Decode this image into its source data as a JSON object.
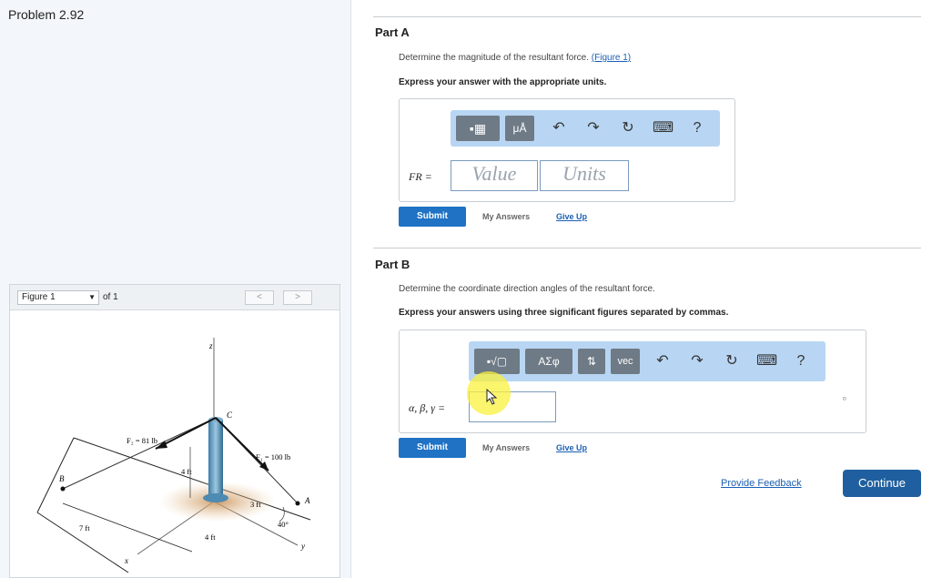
{
  "problem": {
    "title": "Problem 2.92"
  },
  "figure_panel": {
    "select_value": "Figure 1",
    "of_label": "of 1",
    "prev": "<",
    "next": ">",
    "labels": {
      "z": "z",
      "y": "y",
      "x": "x",
      "A": "A",
      "B": "B",
      "C": "C",
      "F2": "F₂ = 81 lb",
      "F1": "F₁ = 100 lb",
      "h": "4 ft",
      "d3": "3 ft",
      "d7": "7 ft",
      "d4": "4 ft",
      "ang": "40°"
    }
  },
  "partA": {
    "title": "Part A",
    "desc": "Determine the magnitude of the resultant force.",
    "figure_link": "(Figure 1)",
    "instr": "Express your answer with the appropriate units.",
    "toolbar": {
      "templates": "▪▦",
      "units": "μÅ",
      "undo": "↶",
      "redo": "↷",
      "reset": "↻",
      "keyboard": "⌨",
      "help": "?"
    },
    "var_label": "FR =",
    "value_placeholder": "Value",
    "units_placeholder": "Units",
    "submit": "Submit",
    "my_answers": "My Answers",
    "give_up": "Give Up"
  },
  "partB": {
    "title": "Part B",
    "desc": "Determine the coordinate direction angles of the resultant force.",
    "instr": "Express your answers using three significant figures separated by commas.",
    "toolbar": {
      "templates": "▪√▢",
      "greek": "ΑΣφ",
      "arrows": "⇅",
      "vec": "vec",
      "undo": "↶",
      "redo": "↷",
      "reset": "↻",
      "keyboard": "⌨",
      "help": "?"
    },
    "var_label": "α, β, γ =",
    "degree": "°",
    "submit": "Submit",
    "my_answers": "My Answers",
    "give_up": "Give Up"
  },
  "footer": {
    "feedback": "Provide Feedback",
    "continue": "Continue"
  },
  "colors": {
    "primary": "#1f72c4",
    "continue": "#1f5f9f",
    "toolbar": "#b8d6f3",
    "highlight": "#faf03c"
  }
}
